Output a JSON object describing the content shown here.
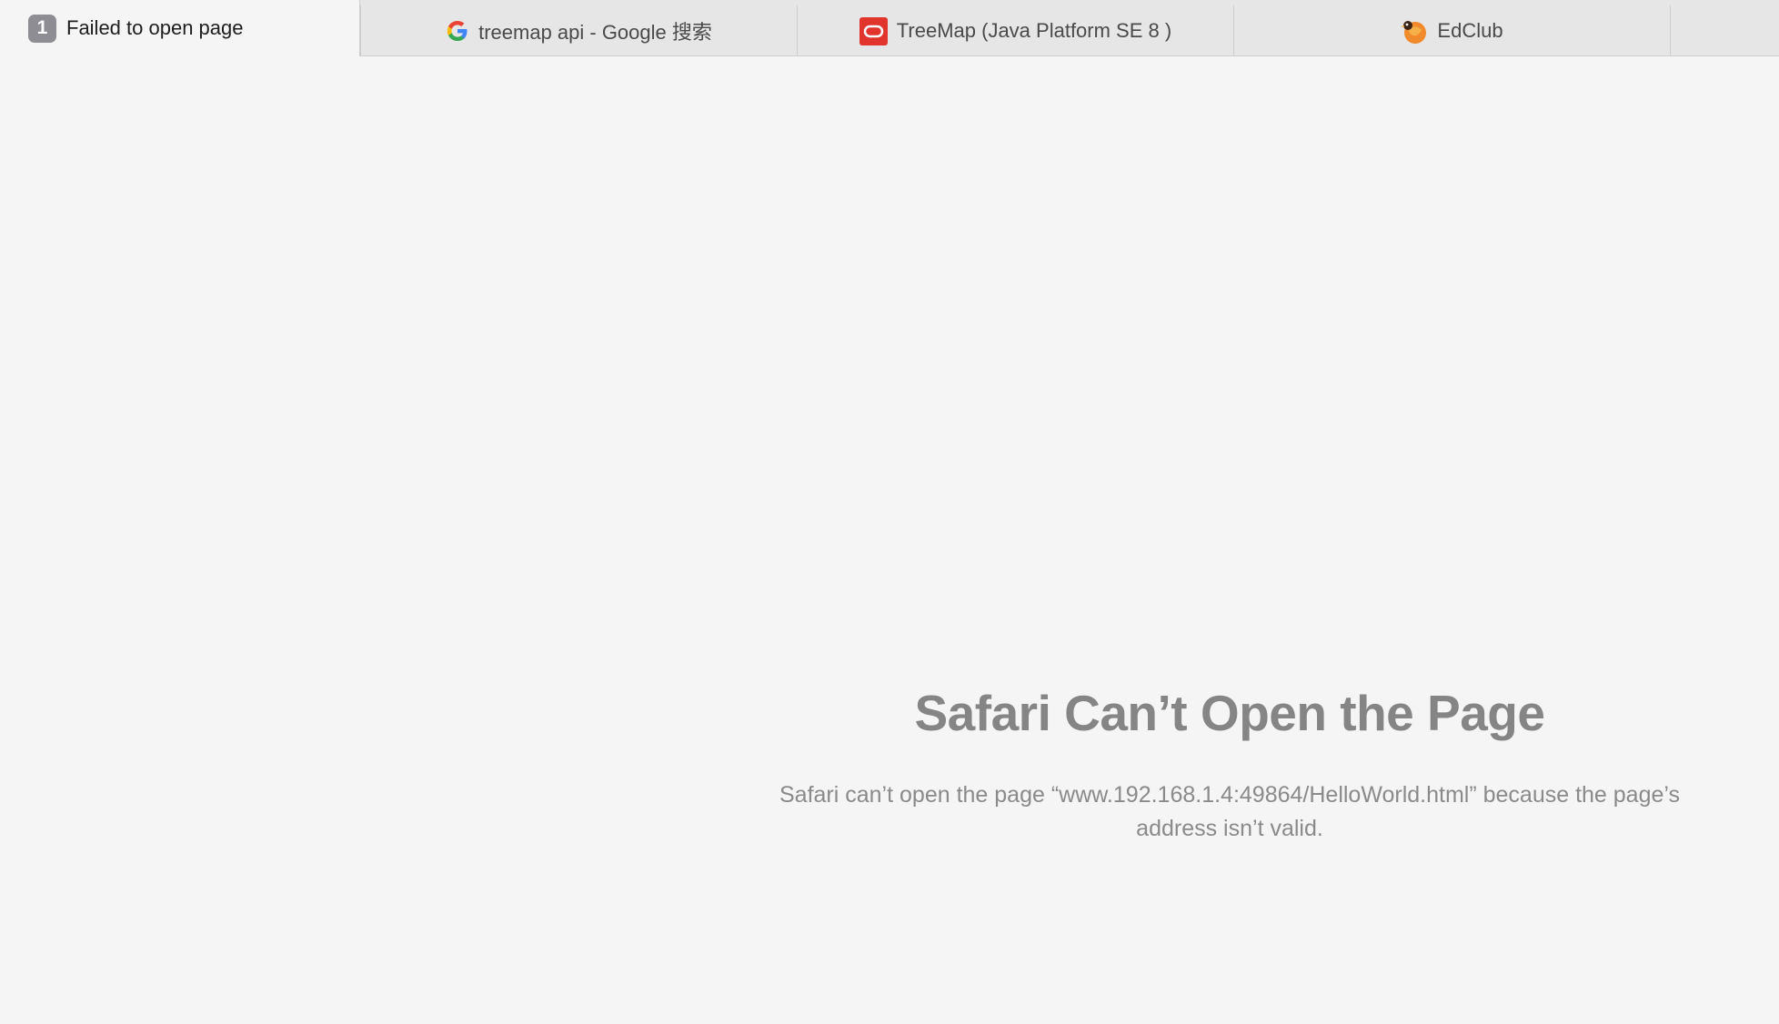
{
  "tabs": [
    {
      "number": "1",
      "label": "Failed to open page",
      "icon": "tab-number-badge",
      "active": true
    },
    {
      "label": "treemap api - Google 搜索",
      "icon": "google-icon",
      "active": false
    },
    {
      "label": "TreeMap (Java Platform SE 8 )",
      "icon": "oracle-icon",
      "active": false
    },
    {
      "label": "EdClub",
      "icon": "edclub-icon",
      "active": false
    }
  ],
  "error": {
    "title": "Safari Can’t Open the Page",
    "message": "Safari can’t open the page “www.192.168.1.4:49864/HelloWorld.html” because the page’s address isn’t valid."
  },
  "colors": {
    "page_background": "#f5f5f5",
    "tabbar_background": "#e6e6e6",
    "title_text": "#858585",
    "message_text": "#8a8a8a",
    "badge": "#8d8d93",
    "oracle_red": "#e0342c"
  }
}
